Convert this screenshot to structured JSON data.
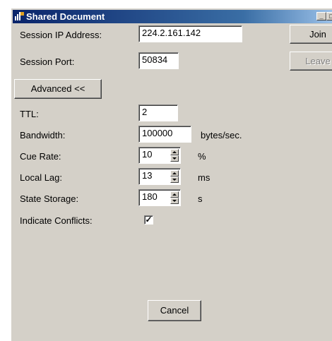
{
  "window": {
    "title": "Shared Document",
    "controls": {
      "minimize": "_",
      "maximize": "□",
      "close": "×"
    }
  },
  "session": {
    "ip_label": "Session IP Address:",
    "ip_value": "224.2.161.142",
    "port_label": "Session Port:",
    "port_value": "50834"
  },
  "buttons": {
    "join": "Join",
    "leave": "Leave",
    "advanced": "Advanced <<",
    "cancel": "Cancel"
  },
  "advanced": {
    "ttl_label": "TTL:",
    "ttl_value": "2",
    "bandwidth_label": "Bandwidth:",
    "bandwidth_value": "100000",
    "bandwidth_unit": "bytes/sec.",
    "cue_rate_label": "Cue Rate:",
    "cue_rate_value": "10",
    "cue_rate_unit": "%",
    "local_lag_label": "Local Lag:",
    "local_lag_value": "13",
    "local_lag_unit": "ms",
    "state_storage_label": "State Storage:",
    "state_storage_value": "180",
    "state_storage_unit": "s",
    "indicate_conflicts_label": "Indicate Conflicts:",
    "indicate_conflicts_checked": true,
    "check_mark": "✓"
  },
  "colors": {
    "title_bar_start": "#0a246a",
    "title_bar_end": "#a6caf0",
    "dialog_face": "#d4d0c8"
  }
}
